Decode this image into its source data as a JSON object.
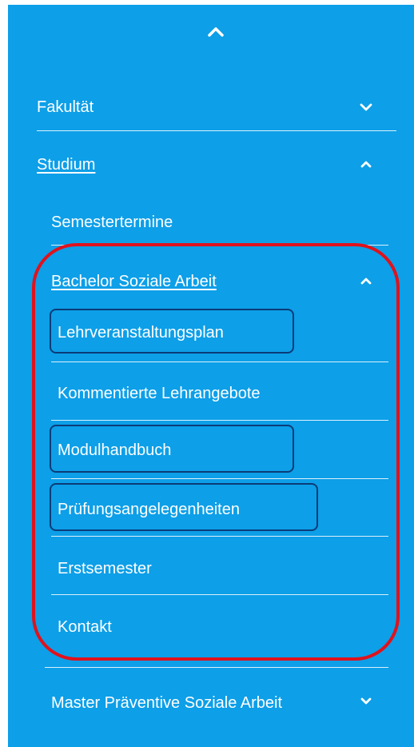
{
  "nav": {
    "collapse_label": "",
    "items": [
      {
        "label": "Fakultät"
      },
      {
        "label": "Studium"
      },
      {
        "label": "Semestertermine"
      },
      {
        "label": "Bachelor Soziale Arbeit"
      },
      {
        "label": "Lehrveranstaltungsplan"
      },
      {
        "label": "Kommentierte Lehrangebote"
      },
      {
        "label": "Modulhandbuch"
      },
      {
        "label": "Prüfungsangelegenheiten"
      },
      {
        "label": "Erstsemester"
      },
      {
        "label": "Kontakt"
      },
      {
        "label": "Master Präventive Soziale Arbeit"
      }
    ]
  },
  "colors": {
    "panel_bg": "#0d9fe8",
    "text": "#ffffff",
    "highlight_red": "#e0121c",
    "highlight_navy": "#0b3c78"
  },
  "icons": {
    "top": "chevron-up-icon",
    "faculty": "chevron-down-icon",
    "study": "chevron-up-icon",
    "bachelor": "chevron-up-icon",
    "master": "chevron-down-icon"
  }
}
